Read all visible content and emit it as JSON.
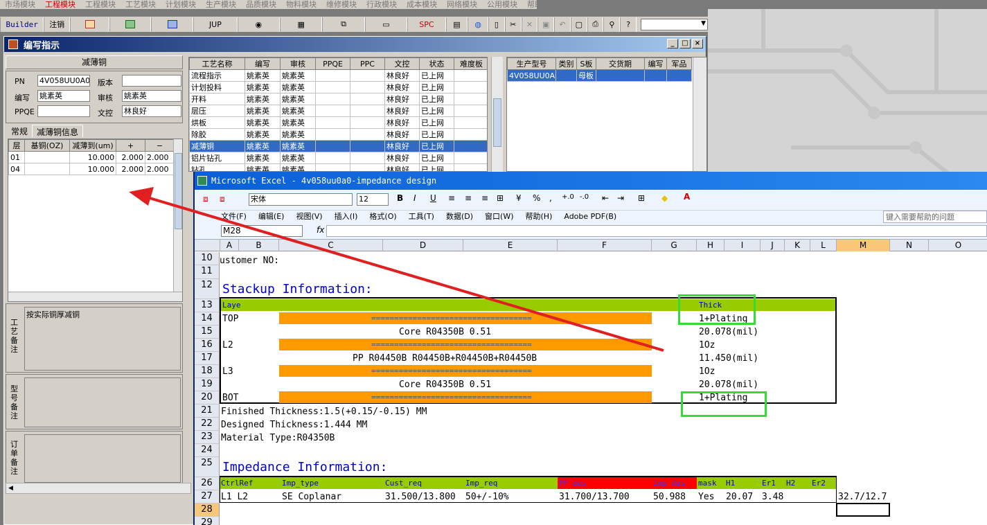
{
  "menubar": [
    "市场模块",
    "工程模块",
    "工艺模块",
    "计划模块",
    "生产模块",
    "品质模块",
    "物料模块",
    "维修模块",
    "行政模块",
    "成本模块",
    "网络模块",
    "公用模块",
    "帮助"
  ],
  "toolbar": {
    "builder": "Builder",
    "logout": "注销",
    "jup": "JUP",
    "spc": "SPC"
  },
  "window": {
    "title": "编写指示"
  },
  "left": {
    "header": "减薄铜",
    "pn_label": "PN",
    "pn_value": "4V058UU0A0",
    "version_label": "版本",
    "version_value": "",
    "writer_label": "编写",
    "writer_value": "姚素英",
    "reviewer_label": "审核",
    "reviewer_value": "姚素英",
    "ppqe_label": "PPQE",
    "ppqe_value": "",
    "doc_label": "文控",
    "doc_value": "林良好",
    "tab_general": "常规",
    "tab_info": "减薄铜信息",
    "cols": [
      "层",
      "基铜(OZ)",
      "减薄到(um)",
      "+",
      "−"
    ],
    "rows": [
      [
        "01",
        "",
        "10.000",
        "2.000",
        "2.000"
      ],
      [
        "04",
        "",
        "10.000",
        "2.000",
        "2.000"
      ]
    ],
    "note1_label": "工艺备注",
    "note1_text": "按实际铜厚减铜",
    "note2_label": "型号备注",
    "note3_label": "订单备注"
  },
  "process": {
    "cols": [
      "工艺名称",
      "编写",
      "审核",
      "PPQE",
      "PPC",
      "文控",
      "状态",
      "难度板"
    ],
    "rows": [
      [
        "流程指示",
        "姚素英",
        "姚素英",
        "",
        "",
        "林良好",
        "已上网",
        ""
      ],
      [
        "计划投料",
        "姚素英",
        "姚素英",
        "",
        "",
        "林良好",
        "已上网",
        ""
      ],
      [
        "开料",
        "姚素英",
        "姚素英",
        "",
        "",
        "林良好",
        "已上网",
        ""
      ],
      [
        "层压",
        "姚素英",
        "姚素英",
        "",
        "",
        "林良好",
        "已上网",
        ""
      ],
      [
        "烘板",
        "姚素英",
        "姚素英",
        "",
        "",
        "林良好",
        "已上网",
        ""
      ],
      [
        "除胶",
        "姚素英",
        "姚素英",
        "",
        "",
        "林良好",
        "已上网",
        ""
      ],
      [
        "减薄铜",
        "姚素英",
        "姚素英",
        "",
        "",
        "林良好",
        "已上网",
        ""
      ],
      [
        "铝片钻孔",
        "姚素英",
        "姚素英",
        "",
        "",
        "林良好",
        "已上网",
        ""
      ],
      [
        "钻孔",
        "姚素英",
        "姚素英",
        "",
        "",
        "林良好",
        "已上网",
        ""
      ]
    ]
  },
  "models": {
    "cols": [
      "生产型号",
      "类别",
      "S板",
      "交货期",
      "编写",
      "军品"
    ],
    "rows": [
      [
        "4V058UU0A0",
        "",
        "母板",
        "",
        "",
        ""
      ]
    ]
  },
  "excel": {
    "title": "Microsoft Excel - 4v058uu0a0-impedance design",
    "font": "宋体",
    "size": "12",
    "menu": [
      "文件(F)",
      "编辑(E)",
      "视图(V)",
      "插入(I)",
      "格式(O)",
      "工具(T)",
      "数据(D)",
      "窗口(W)",
      "帮助(H)",
      "Adobe PDF(B)"
    ],
    "help_placeholder": "键入需要帮助的问题",
    "namebox": "M28",
    "fx": "fx",
    "columns": [
      "A",
      "B",
      "C",
      "D",
      "E",
      "F",
      "G",
      "H",
      "I",
      "J",
      "K",
      "L",
      "M",
      "N",
      "O"
    ],
    "row_numbers": [
      "10",
      "11",
      "12",
      "13",
      "14",
      "15",
      "16",
      "17",
      "18",
      "19",
      "20",
      "21",
      "22",
      "23",
      "24",
      "25",
      "26",
      "27",
      "28",
      "29"
    ],
    "customer": "ustomer NO:",
    "stackup_title": "Stackup Information:",
    "layer_hdr": "Laye",
    "thick_hdr": "Thick",
    "eq": "===================================",
    "r14a": "TOP",
    "r14h": "1+Plating",
    "r15": "Core    R04350B    0.51",
    "r15h": "20.078(mil)",
    "r16a": "L2",
    "r16h": "1Oz",
    "r17": "PP    R04450B    R04450B+R04450B+R04450B",
    "r17h": "11.450(mil)",
    "r18a": "L3",
    "r18h": "1Oz",
    "r19": "Core    R04350B    0.51",
    "r19h": "20.078(mil)",
    "r20a": "BOT",
    "r20h": "1+Plating",
    "r21": "Finished Thickness:1.5(+0.15/-0.15) MM",
    "r22": "Designed Thickness:1.444 MM",
    "r23": "Material Type:R04350B",
    "imp_title": "Impedance Information:",
    "imp_hdr": [
      "CtrlRef",
      "Imp_type",
      "Cust_req",
      "Imp_req",
      "PP_des",
      "Imp_des",
      "mask",
      "H1",
      "Er1",
      "H2",
      "Er2"
    ],
    "imp_row": [
      "L1  L2",
      "SE Coplanar",
      "31.500/13.800",
      "50+/-10%",
      "31.700/13.700",
      "50.988",
      "Yes",
      "20.07",
      "3.48",
      "",
      ""
    ],
    "m27": "32.7/12.7"
  }
}
